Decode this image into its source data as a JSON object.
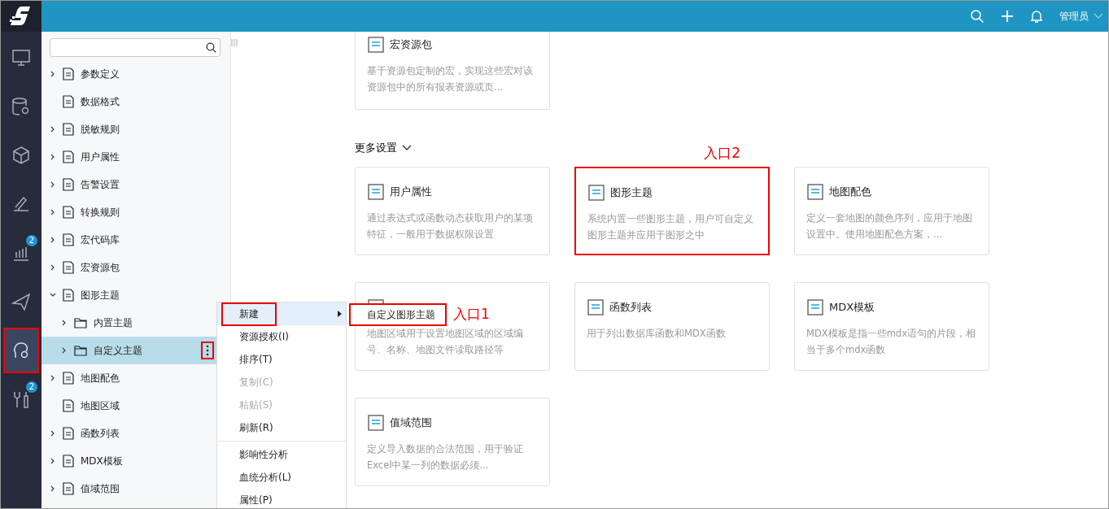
{
  "header": {
    "user": "管理员"
  },
  "rail": [
    {
      "selected": false
    },
    {
      "selected": false
    },
    {
      "selected": false
    },
    {
      "selected": false
    },
    {
      "selected": false,
      "badge": "2"
    },
    {
      "selected": false
    },
    {
      "selected": true,
      "marked": true
    },
    {
      "selected": false,
      "badge": "2"
    }
  ],
  "splitter": {
    "grip": "|||"
  },
  "tree": {
    "items": [
      {
        "label": "参数定义",
        "expanded": false,
        "selected": false
      },
      {
        "label": "数据格式",
        "selected": false
      },
      {
        "label": "脱敏规则",
        "expanded": false,
        "selected": false
      },
      {
        "label": "用户属性",
        "expanded": false,
        "selected": false
      },
      {
        "label": "告警设置",
        "expanded": false,
        "selected": false
      },
      {
        "label": "转换规则",
        "expanded": false,
        "selected": false
      },
      {
        "label": "宏代码库",
        "expanded": false,
        "selected": false
      },
      {
        "label": "宏资源包",
        "expanded": false,
        "selected": false
      },
      {
        "label": "图形主题",
        "expanded": true,
        "selected": false,
        "children": [
          {
            "label": "内置主题",
            "expanded": false,
            "selected": false
          },
          {
            "label": "自定义主题",
            "expanded": false,
            "selected": true,
            "more_marked": true
          }
        ]
      },
      {
        "label": "地图配色",
        "expanded": false,
        "selected": false
      },
      {
        "label": "地图区域",
        "selected": false
      },
      {
        "label": "函数列表",
        "expanded": false,
        "selected": false
      },
      {
        "label": "MDX模板",
        "expanded": false,
        "selected": false
      },
      {
        "label": "值域范围",
        "expanded": false,
        "selected": false
      }
    ]
  },
  "content": {
    "top_cards": [
      {
        "title": "宏资源包",
        "description": "基于资源包定制的宏，实现这些宏对该资源包中的所有报表资源或页..."
      }
    ],
    "section_title": "更多设置",
    "cards": [
      {
        "title": "用户属性",
        "description": "通过表达式或函数动态获取用户的某项特征，一般用于数据权限设置"
      },
      {
        "title": "图形主题",
        "description": "系统内置一些图形主题，用户可自定义图形主题并应用于图形之中",
        "marked": true,
        "callout": "入口2"
      },
      {
        "title": "地图配色",
        "description": "定义一套地图的颜色序列，应用于地图设置中。使用地图配色方案，..."
      },
      {
        "description": "地图区域用于设置地图区域的区域编号、名称、地图文件读取路径等"
      },
      {
        "title": "函数列表",
        "description": "用于列出数据库函数和MDX函数"
      },
      {
        "title": "MDX模板",
        "description": "MDX模板是指一些mdx语句的片段，相当于多个mdx函数"
      },
      {
        "title": "值域范围",
        "description": "定义导入数据的合法范围，用于验证Excel中某一列的数据必须..."
      }
    ]
  },
  "context_menu": {
    "items": [
      {
        "label": "新建",
        "kind": "submenu",
        "disabled": false,
        "selected": true,
        "marked": true
      },
      {
        "label": "资源授权(I)",
        "kind": "item",
        "disabled": false,
        "selected": false
      },
      {
        "label": "排序(T)",
        "kind": "item",
        "disabled": false,
        "selected": false
      },
      {
        "label": "复制(C)",
        "kind": "item",
        "disabled": true,
        "selected": false
      },
      {
        "label": "粘贴(S)",
        "kind": "item",
        "disabled": true,
        "selected": false
      },
      {
        "label": "刷新(R)",
        "kind": "item",
        "disabled": false,
        "selected": false
      },
      {
        "label": "影响性分析",
        "kind": "item",
        "disabled": false,
        "selected": false,
        "divider_before": true
      },
      {
        "label": "血统分析(L)",
        "kind": "item",
        "disabled": false,
        "selected": false
      },
      {
        "label": "属性(P)",
        "kind": "item",
        "disabled": false,
        "selected": false
      }
    ],
    "submenu": {
      "items": [
        {
          "label": "自定义图形主题",
          "marked": true
        }
      ],
      "callout": "入口1"
    }
  }
}
